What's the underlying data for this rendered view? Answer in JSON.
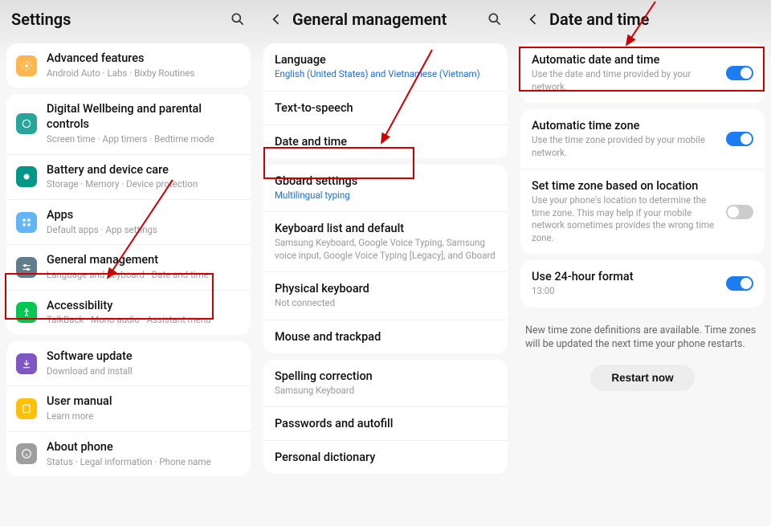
{
  "panel1": {
    "title": "Settings",
    "items": [
      {
        "label": "Advanced features",
        "sub": "Android Auto · Labs · Bixby Routines"
      },
      {
        "label": "Digital Wellbeing and parental controls",
        "sub": "Screen time · App timers · Bedtime mode"
      },
      {
        "label": "Battery and device care",
        "sub": "Storage · Memory · Device protection"
      },
      {
        "label": "Apps",
        "sub": "Default apps · App settings"
      },
      {
        "label": "General management",
        "sub": "Language and keyboard · Date and time"
      },
      {
        "label": "Accessibility",
        "sub": "TalkBack · Mono audio · Assistant menu"
      },
      {
        "label": "Software update",
        "sub": "Download and install"
      },
      {
        "label": "User manual",
        "sub": "Learn more"
      },
      {
        "label": "About phone",
        "sub": "Status · Legal information · Phone name"
      }
    ]
  },
  "panel2": {
    "title": "General management",
    "groups": [
      [
        {
          "label": "Language",
          "sub": "English (United States) and Vietnamese (Vietnam)",
          "link": true
        },
        {
          "label": "Text-to-speech"
        },
        {
          "label": "Date and time"
        }
      ],
      [
        {
          "label": "Gboard settings",
          "sub": "Multilingual typing",
          "link": true
        },
        {
          "label": "Keyboard list and default",
          "sub": "Samsung Keyboard, Google Voice Typing, Samsung voice input, Google Voice Typing [Legacy], and Gboard"
        },
        {
          "label": "Physical keyboard",
          "sub": "Not connected"
        },
        {
          "label": "Mouse and trackpad"
        }
      ],
      [
        {
          "label": "Spelling correction",
          "sub": "Samsung Keyboard"
        },
        {
          "label": "Passwords and autofill"
        },
        {
          "label": "Personal dictionary"
        }
      ]
    ]
  },
  "panel3": {
    "title": "Date and time",
    "groups": [
      [
        {
          "label": "Automatic date and time",
          "sub": "Use the date and time provided by your network.",
          "on": true
        }
      ],
      [
        {
          "label": "Automatic time zone",
          "sub": "Use the time zone provided by your mobile network.",
          "on": true
        },
        {
          "label": "Set time zone based on location",
          "sub": "Use your phone's location to determine the time zone. This may help if your mobile network sometimes provides the wrong time zone.",
          "on": false
        }
      ],
      [
        {
          "label": "Use 24-hour format",
          "sub": "13:00",
          "on": true
        }
      ]
    ],
    "note": "New time zone definitions are available. Time zones will be updated the next time your phone restarts.",
    "restart": "Restart now"
  }
}
